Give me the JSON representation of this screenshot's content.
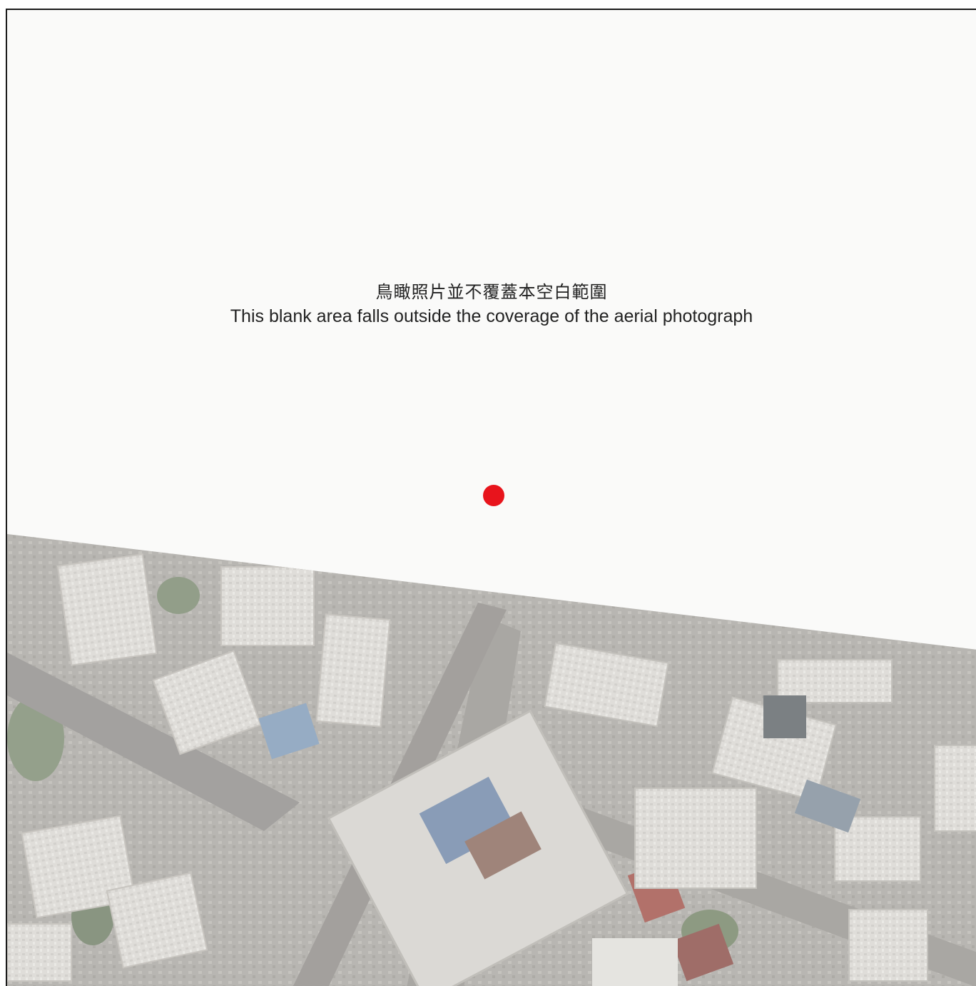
{
  "notice": {
    "chinese": "鳥瞰照片並不覆蓋本空白範圍",
    "english": "This blank area falls outside the coverage of the aerial photograph"
  },
  "colors": {
    "blank_area": "#fafaf9",
    "marker": "#e8141c",
    "border": "#1a1a1a"
  },
  "marker": {
    "icon": "location-dot-icon"
  }
}
